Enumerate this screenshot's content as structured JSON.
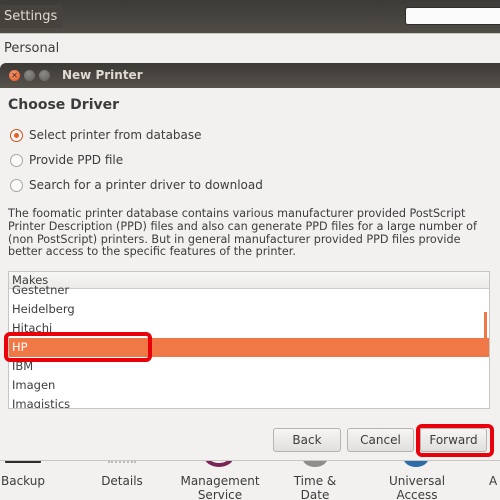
{
  "window": {
    "title": "Settings",
    "search_placeholder": ""
  },
  "section_label": "Personal",
  "dialog": {
    "title": "New Printer",
    "heading": "Choose Driver",
    "options": [
      {
        "label": "Select printer from database",
        "checked": true
      },
      {
        "label": "Provide PPD file",
        "checked": false
      },
      {
        "label": "Search for a printer driver to download",
        "checked": false
      }
    ],
    "description": "The foomatic printer database contains various manufacturer provided PostScript Printer Description (PPD) files and also can generate PPD files for a large number of (non PostScript) printers. But in general manufacturer provided PPD files provide better access to the specific features of the printer.",
    "makes_list": {
      "header": "Makes",
      "items": [
        "Gestetner",
        "Heidelberg",
        "Hitachi",
        "HP",
        "IBM",
        "Imagen",
        "Imagistics"
      ],
      "selected": "HP"
    },
    "buttons": {
      "back": "Back",
      "cancel": "Cancel",
      "forward": "Forward"
    }
  },
  "bottom_apps": [
    {
      "label": "Backup",
      "icon": "backup-icon"
    },
    {
      "label": "Details",
      "icon": "details-icon"
    },
    {
      "label": "Management Service",
      "icon": "management-service-icon"
    },
    {
      "label": "Time & Date",
      "icon": "clock-icon"
    },
    {
      "label": "Universal Access",
      "icon": "universal-access-icon"
    },
    {
      "label": "A",
      "icon": "accounts-icon"
    }
  ],
  "colors": {
    "accent": "#f07846",
    "highlight_annotation": "#e8000b",
    "titlebar": "#3c3a36"
  }
}
